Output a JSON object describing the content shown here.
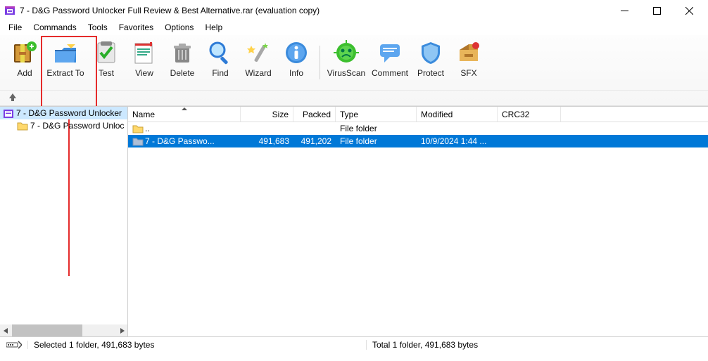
{
  "titlebar": {
    "title": "7 - D&G Password Unlocker Full Review & Best Alternative.rar (evaluation copy)"
  },
  "menubar": [
    "File",
    "Commands",
    "Tools",
    "Favorites",
    "Options",
    "Help"
  ],
  "toolbar": {
    "add": "Add",
    "extract": "Extract To",
    "test": "Test",
    "view": "View",
    "delete": "Delete",
    "find": "Find",
    "wizard": "Wizard",
    "info": "Info",
    "virus": "VirusScan",
    "comment": "Comment",
    "protect": "Protect",
    "sfx": "SFX"
  },
  "tree": {
    "items": [
      {
        "label": "7 - D&G Password Unlocker",
        "indent": 4,
        "rar": true,
        "sel": true
      },
      {
        "label": "7 - D&G Password Unloc",
        "indent": 24,
        "rar": false,
        "sel": false
      }
    ]
  },
  "columns": {
    "name": "Name",
    "size": "Size",
    "packed": "Packed",
    "type": "Type",
    "modified": "Modified",
    "crc": "CRC32"
  },
  "rows": [
    {
      "name": "..",
      "size": "",
      "packed": "",
      "type": "File folder",
      "modified": "",
      "sel": false,
      "up": true
    },
    {
      "name": "7 - D&G Passwo...",
      "size": "491,683",
      "packed": "491,202",
      "type": "File folder",
      "modified": "10/9/2024 1:44 ...",
      "sel": true,
      "up": false
    }
  ],
  "status": {
    "selected": "Selected 1 folder, 491,683 bytes",
    "total": "Total 1 folder, 491,683 bytes"
  }
}
